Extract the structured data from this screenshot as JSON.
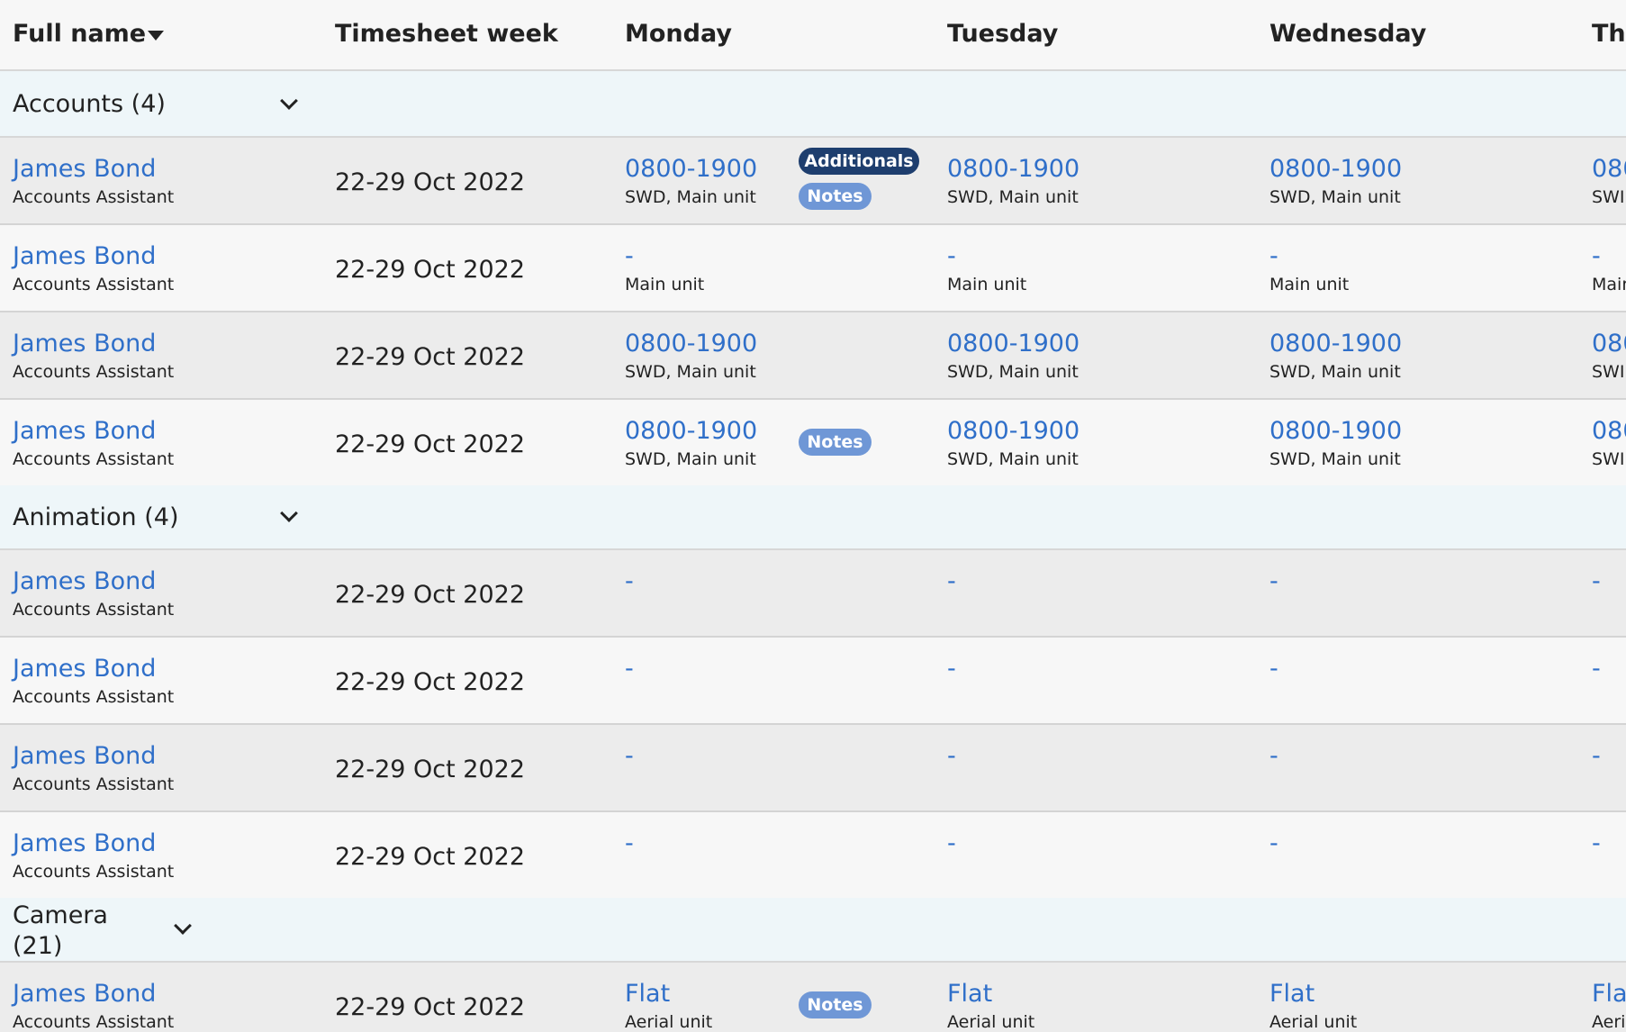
{
  "header": {
    "full_name": "Full name",
    "timesheet_week": "Timesheet week",
    "monday": "Monday",
    "tuesday": "Tuesday",
    "wednesday": "Wednesday",
    "thursday_partial": "Thu"
  },
  "groups": [
    {
      "label": "Accounts (4)",
      "rows": [
        {
          "name": "James Bond",
          "role": "Accounts Assistant",
          "week": "22-29 Oct 2022",
          "days": [
            {
              "time": "0800-1900",
              "unit": "SWD, Main unit"
            },
            {
              "time": "0800-1900",
              "unit": "SWD, Main unit"
            },
            {
              "time": "0800-1900",
              "unit": "SWD, Main unit"
            },
            {
              "time": "080",
              "unit": "SWI"
            }
          ],
          "badges": [
            "Additionals",
            "Notes"
          ]
        },
        {
          "name": "James Bond",
          "role": "Accounts Assistant",
          "week": "22-29 Oct 2022",
          "days": [
            {
              "time": "-",
              "unit": "Main unit"
            },
            {
              "time": "-",
              "unit": "Main unit"
            },
            {
              "time": "-",
              "unit": "Main unit"
            },
            {
              "time": "-",
              "unit": "Mair"
            }
          ],
          "badges": []
        },
        {
          "name": "James Bond",
          "role": "Accounts Assistant",
          "week": "22-29 Oct 2022",
          "days": [
            {
              "time": "0800-1900",
              "unit": "SWD, Main unit"
            },
            {
              "time": "0800-1900",
              "unit": "SWD, Main unit"
            },
            {
              "time": "0800-1900",
              "unit": "SWD, Main unit"
            },
            {
              "time": "080",
              "unit": "SWI"
            }
          ],
          "badges": []
        },
        {
          "name": "James Bond",
          "role": "Accounts Assistant",
          "week": "22-29 Oct 2022",
          "days": [
            {
              "time": "0800-1900",
              "unit": "SWD, Main unit"
            },
            {
              "time": "0800-1900",
              "unit": "SWD, Main unit"
            },
            {
              "time": "0800-1900",
              "unit": "SWD, Main unit"
            },
            {
              "time": "080",
              "unit": "SWI"
            }
          ],
          "badges": [
            "Notes"
          ]
        }
      ]
    },
    {
      "label": "Animation (4)",
      "rows": [
        {
          "name": "James Bond",
          "role": "Accounts Assistant",
          "week": "22-29 Oct 2022",
          "days": [
            {
              "time": "-",
              "unit": ""
            },
            {
              "time": "-",
              "unit": ""
            },
            {
              "time": "-",
              "unit": ""
            },
            {
              "time": "-",
              "unit": ""
            }
          ],
          "badges": []
        },
        {
          "name": "James Bond",
          "role": "Accounts Assistant",
          "week": "22-29 Oct 2022",
          "days": [
            {
              "time": "-",
              "unit": ""
            },
            {
              "time": "-",
              "unit": ""
            },
            {
              "time": "-",
              "unit": ""
            },
            {
              "time": "-",
              "unit": ""
            }
          ],
          "badges": []
        },
        {
          "name": "James Bond",
          "role": "Accounts Assistant",
          "week": "22-29 Oct 2022",
          "days": [
            {
              "time": "-",
              "unit": ""
            },
            {
              "time": "-",
              "unit": ""
            },
            {
              "time": "-",
              "unit": ""
            },
            {
              "time": "-",
              "unit": ""
            }
          ],
          "badges": []
        },
        {
          "name": "James Bond",
          "role": "Accounts Assistant",
          "week": "22-29 Oct 2022",
          "days": [
            {
              "time": "-",
              "unit": ""
            },
            {
              "time": "-",
              "unit": ""
            },
            {
              "time": "-",
              "unit": ""
            },
            {
              "time": "-",
              "unit": ""
            }
          ],
          "badges": []
        }
      ]
    },
    {
      "label_line1": "Camera",
      "label_line2": "(21)",
      "rows": [
        {
          "name": "James Bond",
          "role": "Accounts Assistant",
          "week": "22-29 Oct 2022",
          "days": [
            {
              "time": "Flat",
              "unit": "Aerial unit"
            },
            {
              "time": "Flat",
              "unit": "Aerial unit"
            },
            {
              "time": "Flat",
              "unit": "Aerial unit"
            },
            {
              "time": "Fla",
              "unit": "Aeri"
            }
          ],
          "badges": [
            "Notes"
          ]
        }
      ]
    }
  ],
  "colors": {
    "link": "#2f6fc9",
    "group_bg": "#eef6f9",
    "additionals_badge": "#1e3e6e",
    "notes_badge": "#6f97d6"
  }
}
